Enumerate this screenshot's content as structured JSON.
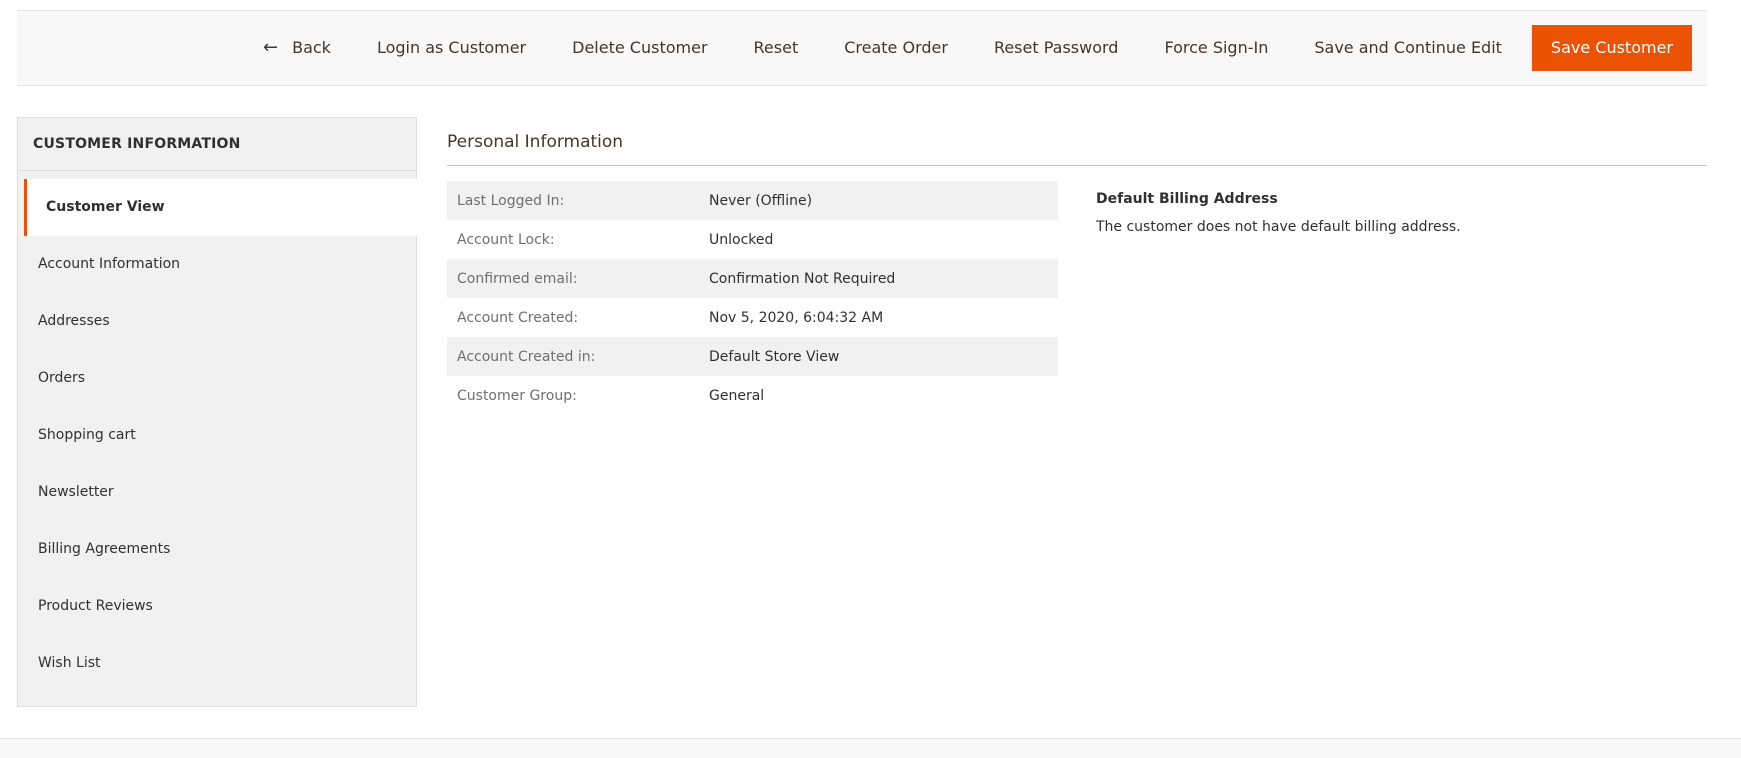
{
  "toolbar": {
    "back_label": "Back",
    "login_as_customer": "Login as Customer",
    "delete_customer": "Delete Customer",
    "reset": "Reset",
    "create_order": "Create Order",
    "reset_password": "Reset Password",
    "force_sign_in": "Force Sign-In",
    "save_continue": "Save and Continue Edit",
    "save_customer": "Save Customer",
    "back_icon": "arrow-left-icon"
  },
  "sidebar": {
    "title": "CUSTOMER INFORMATION",
    "items": [
      {
        "label": "Customer View"
      },
      {
        "label": "Account Information"
      },
      {
        "label": "Addresses"
      },
      {
        "label": "Orders"
      },
      {
        "label": "Shopping cart"
      },
      {
        "label": "Newsletter"
      },
      {
        "label": "Billing Agreements"
      },
      {
        "label": "Product Reviews"
      },
      {
        "label": "Wish List"
      }
    ]
  },
  "main": {
    "section_title": "Personal Information",
    "rows": [
      {
        "label": "Last Logged In:",
        "value": "Never (Offline)"
      },
      {
        "label": "Account Lock:",
        "value": "Unlocked"
      },
      {
        "label": "Confirmed email:",
        "value": "Confirmation Not Required"
      },
      {
        "label": "Account Created:",
        "value": "Nov 5, 2020, 6:04:32 AM"
      },
      {
        "label": "Account Created in:",
        "value": "Default Store View"
      },
      {
        "label": "Customer Group:",
        "value": "General"
      }
    ],
    "billing_title": "Default Billing Address",
    "billing_text": "The customer does not have default billing address."
  },
  "colors": {
    "accent": "#eb5202",
    "toolbar_bg": "#f8f8f8",
    "sidebar_bg": "#f1f1f1"
  }
}
